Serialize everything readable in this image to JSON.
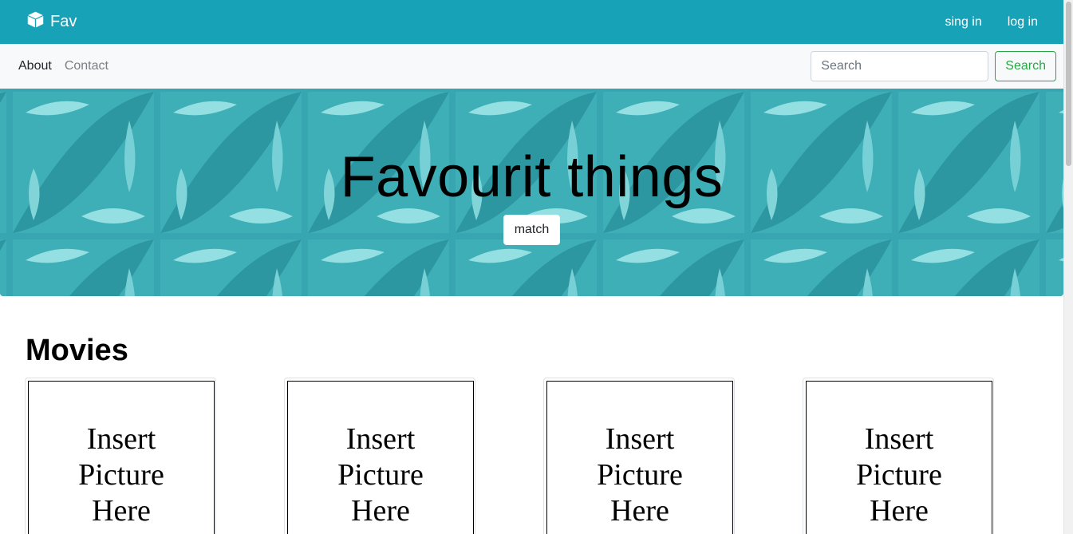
{
  "navbar": {
    "brand": "Fav",
    "brand_icon": "box-icon",
    "links": [
      "sing in",
      "log in"
    ]
  },
  "subnav": {
    "links": [
      "About",
      "Contact"
    ],
    "search_placeholder": "Search",
    "search_button": "Search"
  },
  "hero": {
    "title": "Favourit things",
    "button": "match"
  },
  "movies": {
    "title": "Movies",
    "cards": [
      {
        "line1": "Insert",
        "line2": "Picture",
        "line3": "Here"
      },
      {
        "line1": "Insert",
        "line2": "Picture",
        "line3": "Here"
      },
      {
        "line1": "Insert",
        "line2": "Picture",
        "line3": "Here"
      },
      {
        "line1": "Insert",
        "line2": "Picture",
        "line3": "Here"
      }
    ]
  },
  "colors": {
    "navbar_bg": "#17a2b8",
    "subnav_bg": "#f8f9fa",
    "success": "#28a745",
    "hero_tint": "#3aa6b0"
  }
}
